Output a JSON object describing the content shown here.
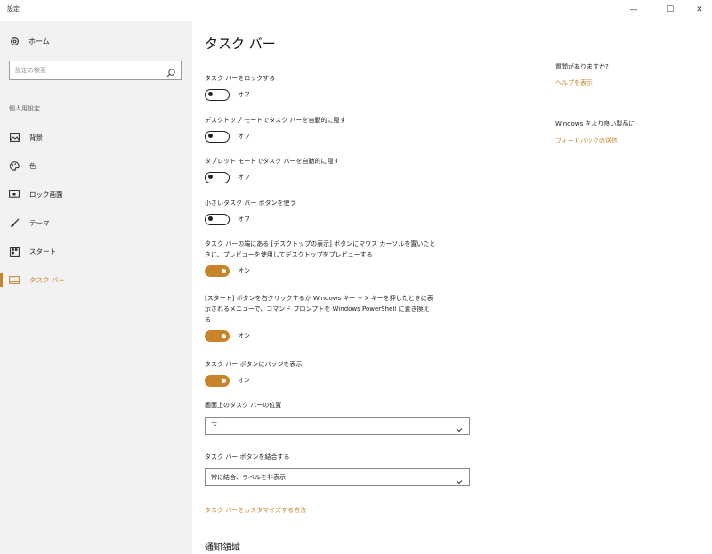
{
  "window": {
    "title": "設定",
    "minimize_glyph": "—",
    "maximize_glyph": "☐",
    "close_glyph": "✕"
  },
  "sidebar": {
    "home_label": "ホーム",
    "search_placeholder": "設定の検索",
    "section_label": "個人用設定",
    "items": [
      {
        "label": "背景",
        "icon": "picture-icon",
        "active": false
      },
      {
        "label": "色",
        "icon": "palette-icon",
        "active": false
      },
      {
        "label": "ロック画面",
        "icon": "lock-screen-icon",
        "active": false
      },
      {
        "label": "テーマ",
        "icon": "brush-icon",
        "active": false
      },
      {
        "label": "スタート",
        "icon": "start-menu-icon",
        "active": false
      },
      {
        "label": "タスク バー",
        "icon": "taskbar-icon",
        "active": true
      }
    ]
  },
  "main": {
    "title": "タスク バー",
    "settings": [
      {
        "label": "タスク バーをロックする",
        "state": "オフ",
        "on": false
      },
      {
        "label": "デスクトップ モードでタスク バーを自動的に隠す",
        "state": "オフ",
        "on": false
      },
      {
        "label": "タブレット モードでタスク バーを自動的に隠す",
        "state": "オフ",
        "on": false
      },
      {
        "label": "小さいタスク バー ボタンを使う",
        "state": "オフ",
        "on": false
      },
      {
        "label_lines": [
          "タスク バーの端にある [デスクトップの表示] ボタンにマウス カーソルを置いたと",
          "きに、プレビューを使用してデスクトップをプレビューする"
        ],
        "state": "オン",
        "on": true
      },
      {
        "label_lines": [
          "[スタート] ボタンを右クリックするか Windows キー + X キーを押したときに表",
          "示されるメニューで、コマンド プロンプトを Windows PowerShell に置き換え",
          "る"
        ],
        "state": "オン",
        "on": true
      },
      {
        "label": "タスク バー ボタンにバッジを表示",
        "state": "オン",
        "on": true
      }
    ],
    "position": {
      "label": "画面上のタスク バーの位置",
      "value": "下"
    },
    "combine": {
      "label": "タスク バー ボタンを結合する",
      "value": "常に結合、ラベルを非表示"
    },
    "customize_link": "タスク バーをカスタマイズする方法",
    "notification_title": "通知領域"
  },
  "right": {
    "question": "質問がありますか?",
    "help_link": "ヘルプを表示",
    "improve": "Windows をより良い製品に",
    "feedback_link": "フィードバックの送信"
  },
  "colors": {
    "accent": "#c8842a",
    "sidebar_bg": "#f2f2f2"
  }
}
